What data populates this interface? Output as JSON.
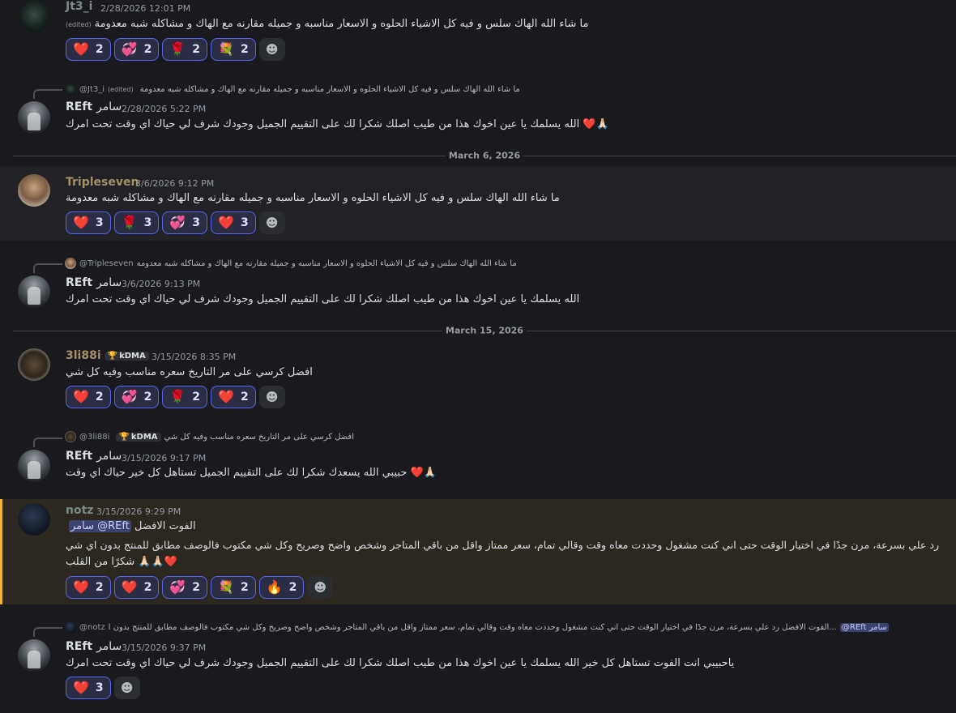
{
  "colors": {
    "background": "#1a1a1e",
    "mention_bg": "#2c2820",
    "mention_bar": "#f0b232",
    "reaction_bg": "#2b2d45",
    "reaction_border": "#5865f2"
  },
  "dividers": [
    "March 6, 2026",
    "March 15, 2026"
  ],
  "messages": [
    {
      "author": "Jt3_i",
      "author_color": "#7b8a88",
      "timestamp": "2/28/2026 12:01 PM",
      "avatar": "moss-avatar",
      "edited": "(edited)",
      "text": "ما شاء الله الهاك سلس و فيه كل الاشياء الحلوه و الاسعار مناسبه و جميله مقارنه مع الهاك و مشاكله شبه معدومة",
      "reactions": [
        {
          "emoji": "❤️",
          "count": "2"
        },
        {
          "emoji": "💞",
          "count": "2"
        },
        {
          "emoji": "🌹",
          "count": "2"
        },
        {
          "emoji": "💐",
          "count": "2"
        }
      ]
    },
    {
      "reply_to": {
        "name": "@Jt3_i",
        "edited": "(edited)",
        "text": "ما شاء الله الهاك سلس و فيه كل الاشياء الحلوه و الاسعار مناسبه و جميله مقارنه مع الهاك و مشاكله شبه معدومة"
      },
      "author_latin": "REft",
      "author_arabic": "سامر",
      "timestamp": "2/28/2026 5:22 PM",
      "text": "الله يسلمك يا عين اخوك هذا من طيب اصلك شكرا لك على التقييم الجميل وجودك شرف لي حياك اي وقت تحت امرك ❤️🙏🏻"
    },
    {
      "author": "Tripleseven",
      "author_color": "#a39069",
      "timestamp": "3/6/2026 9:12 PM",
      "text": "ما شاء الله الهاك سلس و فيه كل الاشياء الحلوه و الاسعار مناسبه و جميله مقارنه مع الهاك و مشاكله شبه معدومة",
      "reactions": [
        {
          "emoji": "❤️",
          "count": "3"
        },
        {
          "emoji": "🌹",
          "count": "3"
        },
        {
          "emoji": "💞",
          "count": "3"
        },
        {
          "emoji": "❤️",
          "count": "3"
        }
      ]
    },
    {
      "reply_to": {
        "name": "@Tripleseven",
        "text": "ما شاء الله الهاك سلس و فيه كل الاشياء الحلوه و الاسعار مناسبه و جميله مقارنه مع الهاك و مشاكله شبه معدومة"
      },
      "author_latin": "REft",
      "author_arabic": "سامر",
      "timestamp": "3/6/2026 9:13 PM",
      "text": "الله يسلمك يا عين اخوك هذا من طيب اصلك شكرا لك على التقييم الجميل وجودك شرف لي حياك اي وقت تحت امرك"
    },
    {
      "author": "3li88i",
      "author_color": "#a39069",
      "badge": "kDMA",
      "timestamp": "3/15/2026 8:35 PM",
      "text": "افضل كرسي على مر التاريخ سعره مناسب وفيه كل شي",
      "reactions": [
        {
          "emoji": "❤️",
          "count": "2"
        },
        {
          "emoji": "💞",
          "count": "2"
        },
        {
          "emoji": "🌹",
          "count": "2"
        },
        {
          "emoji": "❤️",
          "count": "2"
        }
      ]
    },
    {
      "reply_to": {
        "name": "@3li88i",
        "badge": "kDMA",
        "text": "افضل كرسي على مر التاريخ سعره مناسب وفيه كل شي"
      },
      "author_latin": "REft",
      "author_arabic": "سامر",
      "timestamp": "3/15/2026 9:17 PM",
      "text": "حبيبي الله يسعدك شكرا لك على التقييم الجميل تستاهل كل خير حياك اي وقت ❤️🙏🏻"
    },
    {
      "author": "notz",
      "author_color": "#7b8a88",
      "timestamp": "3/15/2026 9:29 PM",
      "mention": "@REft",
      "mention_arabic": "سامر",
      "line1_suffix": "الفوت الافضل",
      "line2": "رد علي بسرعة، مرن جدًا في اختيار الوقت حتى اني كنت مشغول وحددت معاه وقت وقالي تمام، سعر ممتاز واقل من باقي المتاجر وشخص واضح وصريح وكل شي مكتوب فالوصف مطابق للمنتج بدون اي شي",
      "line3": "شكرًا من القلب 🙏🏻🙏🏻❤️",
      "reactions": [
        {
          "emoji": "❤️",
          "count": "2"
        },
        {
          "emoji": "❤️",
          "count": "2"
        },
        {
          "emoji": "💞",
          "count": "2"
        },
        {
          "emoji": "💐",
          "count": "2"
        },
        {
          "emoji": "🔥",
          "count": "2"
        }
      ]
    },
    {
      "reply_to": {
        "name": "@notz",
        "text": "الفوت الافضل  رد علي بسرعة، مرن جدًا في اختيار الوقت حتى اني كنت مشغول وحددت معاه وقت وقالي تمام، سعر ممتاز واقل من باقي المتاجر وشخص واضح وصريح وكل شي مكتوب فالوصف مطابق للمنتج بدون ا...",
        "mention": "@REft",
        "mention_arabic": "سامر"
      },
      "author_latin": "REft",
      "author_arabic": "سامر",
      "timestamp": "3/15/2026 9:37 PM",
      "text": "ياحبيبي انت الفوت تستاهل كل خير الله يسلمك يا عين اخوك هذا من طيب اصلك شكرا لك على التقييم الجميل وجودك شرف لي حياك اي وقت تحت امرك",
      "reactions": [
        {
          "emoji": "❤️",
          "count": "3"
        }
      ]
    }
  ],
  "icons": {
    "add_reaction": "☻",
    "badge": "🏆"
  }
}
